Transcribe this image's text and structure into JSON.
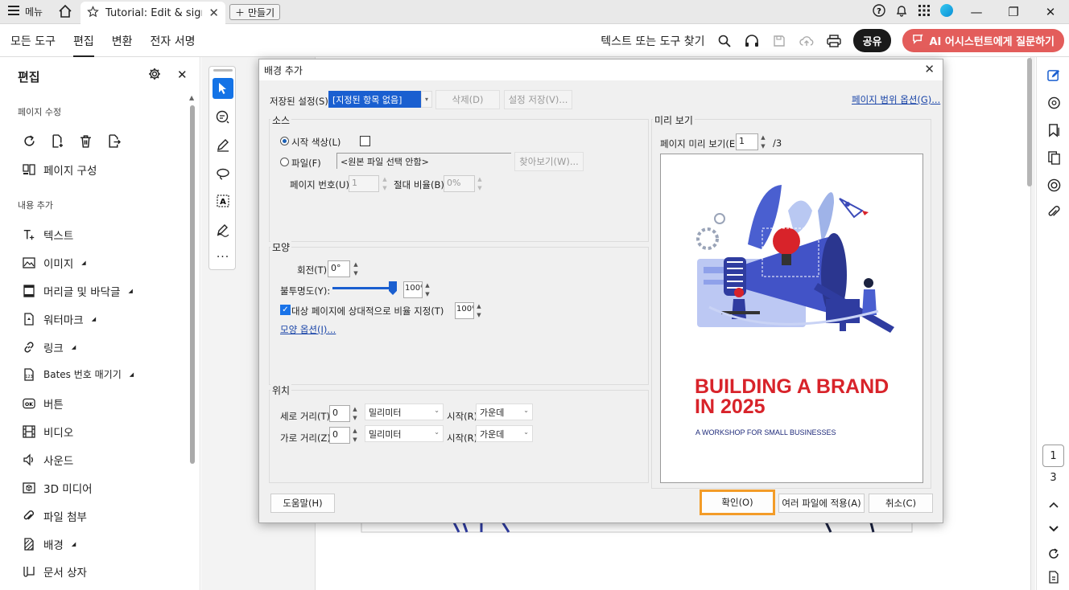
{
  "titlebar": {
    "menu_label": "메뉴",
    "tab_title": "Tutorial: Edit & sign ...",
    "new_tab_label": "만들기"
  },
  "menubar": {
    "tabs": [
      "모든 도구",
      "편집",
      "변환",
      "전자 서명"
    ],
    "active_tab": "편집",
    "search_label": "텍스트 또는 도구 찾기",
    "share_label": "공유",
    "ai_label": "AI 어시스턴트에게 질문하기"
  },
  "leftpanel": {
    "title": "편집",
    "section_page": "페이지 수정",
    "page_org_label": "페이지 구성",
    "section_content": "내용 추가",
    "items": [
      "텍스트",
      "이미지",
      "머리글 및 바닥글",
      "워터마크",
      "링크",
      "Bates 번호 매기기",
      "버튼",
      "비디오",
      "사운드",
      "3D 미디어",
      "파일 첨부",
      "배경",
      "문서 상자"
    ]
  },
  "pager": {
    "current": "1",
    "total": "3"
  },
  "dialog": {
    "title": "배경 추가",
    "saved_settings_label": "저장된 설정(S):",
    "saved_settings_value": "[지정된 항목 없음]",
    "delete_label": "삭제(D)",
    "save_settings_label": "설정 저장(V)...",
    "page_range_link": "페이지 범위 옵션(G)...",
    "source": {
      "title": "소스",
      "from_color_label": "시작 색상(L)",
      "file_label": "파일(F)",
      "file_value": "<원본 파일 선택 안함>",
      "browse_label": "찾아보기(W)...",
      "page_number_label": "페이지 번호(U):",
      "page_number_value": "1",
      "absolute_scale_label": "절대 비율(B):",
      "absolute_scale_value": "0%"
    },
    "appearance": {
      "title": "모양",
      "rotation_label": "회전(T):",
      "rotation_value": "0°",
      "opacity_label": "불투명도(Y):",
      "opacity_value": "100%",
      "opacity_fraction": 1.0,
      "relative_scale_label": "대상 페이지에 상대적으로 비율 지정(T)",
      "relative_scale_value": "100%",
      "appearance_options_link": "모양 옵션(I)..."
    },
    "position": {
      "title": "위치",
      "vertical_label": "세로 거리(T):",
      "vertical_value": "0",
      "vertical_unit": "밀리미터",
      "vertical_from_label": "시작(R)",
      "vertical_from_value": "가운데",
      "horizontal_label": "가로 거리(Z):",
      "horizontal_value": "0",
      "horizontal_unit": "밀리미터",
      "horizontal_from_label": "시작(R)",
      "horizontal_from_value": "가운데"
    },
    "preview": {
      "title": "미리 보기",
      "page_preview_label": "페이지 미리 보기(E)",
      "page_value": "1",
      "page_total": "/3",
      "heading_line1": "BUILDING A BRAND",
      "heading_line2": "IN 2025",
      "subheading": "A WORKSHOP FOR SMALL BUSINESSES"
    },
    "help_label": "도움말(H)",
    "ok_label": "확인(O)",
    "apply_multiple_label": "여러 파일에 적용(A)",
    "cancel_label": "취소(C)"
  },
  "colors": {
    "accent_blue": "#1473e6",
    "ai_button": "#e35d5b",
    "highlight_orange": "#f39c28",
    "brand_red": "#d8232a",
    "illustration_blue": "#4a5fd0"
  }
}
